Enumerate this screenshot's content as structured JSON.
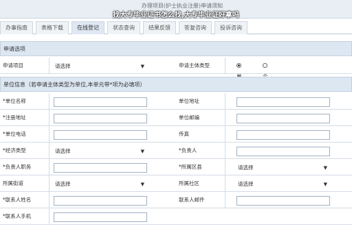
{
  "header": {
    "small_title": "办理项目(护士执业注册)申请须知",
    "overlay_title": "找大专毕业证书怎么找,大专毕业证好拿吗"
  },
  "tabs": [
    {
      "label": "办事指南"
    },
    {
      "label": "表格下载"
    },
    {
      "label": "在线登记"
    },
    {
      "label": "状态查询"
    },
    {
      "label": "结果反馈"
    },
    {
      "label": "答复咨询"
    },
    {
      "label": "投诉咨询"
    }
  ],
  "sections": {
    "apply_option": "申请选项",
    "unit_info": "单位信息（若申请主体类型为单位,本单元带*项为必填项）"
  },
  "apply": {
    "project_label": "申请项目",
    "project_value": "请选择",
    "subject_type_label": "申请主体类型",
    "radio_unit": "单位",
    "radio_personal": "个人"
  },
  "form": {
    "unit_name": "*单位名称",
    "unit_address": "单位地址",
    "reg_address": "*注册地址",
    "unit_postcode": "单位邮编",
    "unit_phone": "*单位电话",
    "fax": "传真",
    "economy_type": "*经济类型",
    "economy_type_value": "请选择",
    "leader": "*负责人",
    "leader_post": "*负责人职务",
    "district": "*所属区县",
    "district_value": "请选择",
    "street": "所属街道",
    "street_value": "请选择",
    "community": "所属社区",
    "community_value": "请选择",
    "contact_name": "*联系人姓名",
    "contact_email": "联系人邮件",
    "contact_mobile": "*联系人手机"
  },
  "colors": {
    "section_bg": "#dde7f2",
    "border": "#c2d1e2",
    "titlebar_bg": "#e9eef4"
  }
}
